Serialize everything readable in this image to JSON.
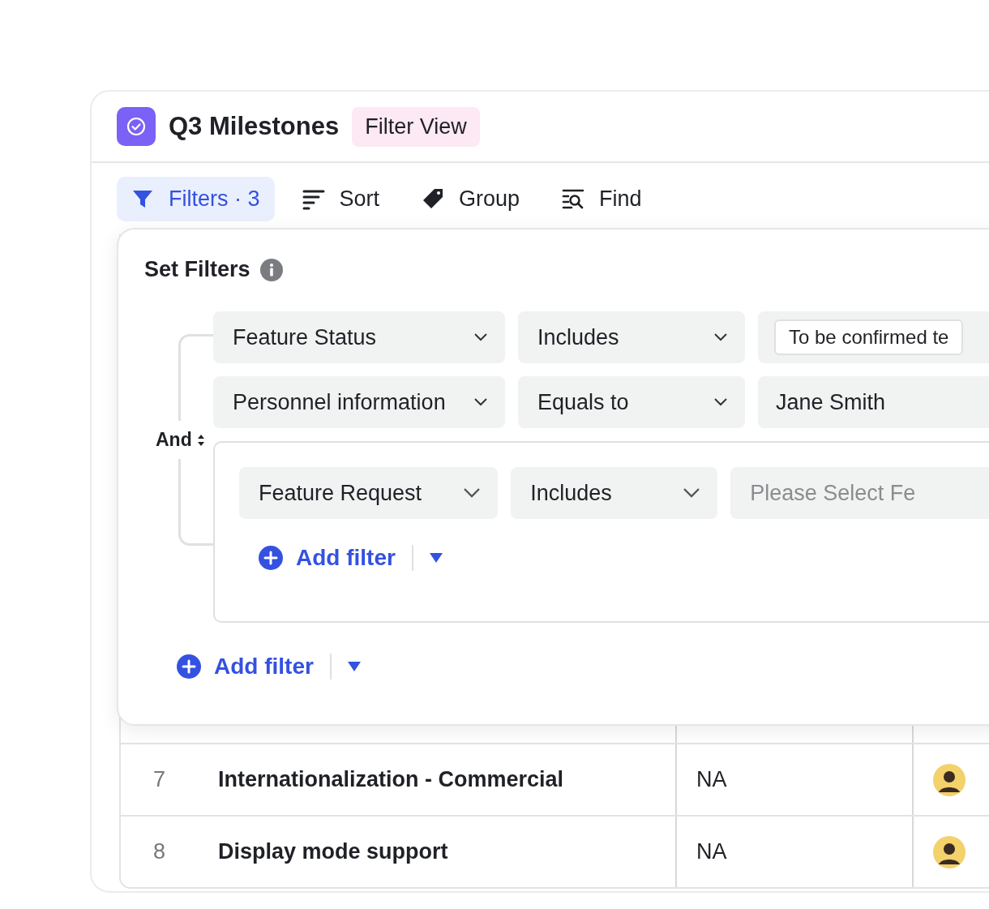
{
  "header": {
    "title": "Q3 Milestones",
    "badge": "Filter View"
  },
  "toolbar": [
    {
      "kind": "filter",
      "label": "Filters · 3",
      "selected": true
    },
    {
      "kind": "sort",
      "label": "Sort",
      "selected": false
    },
    {
      "kind": "group",
      "label": "Group",
      "selected": false
    },
    {
      "kind": "find",
      "label": "Find",
      "selected": false
    }
  ],
  "filter_panel": {
    "title": "Set Filters",
    "conjunction": "And",
    "filters": [
      {
        "kind": "tag",
        "field": "Feature Status",
        "operator": "Includes",
        "value": "To be confirmed te"
      },
      {
        "kind": "text",
        "field": "Personnel information",
        "operator": "Equals to",
        "value": "Jane Smith"
      }
    ],
    "group": {
      "filters": [
        {
          "field": "Feature Request",
          "operator": "Includes",
          "placeholder": "Please Select Fe"
        }
      ],
      "add_button": "Add filter"
    },
    "add_button": "Add filter"
  },
  "table": {
    "rows": [
      {
        "number": "7",
        "name": "Internationalization - Commercial",
        "column_2": "NA"
      },
      {
        "number": "8",
        "name": "Display mode support",
        "column_2": "NA"
      }
    ]
  }
}
